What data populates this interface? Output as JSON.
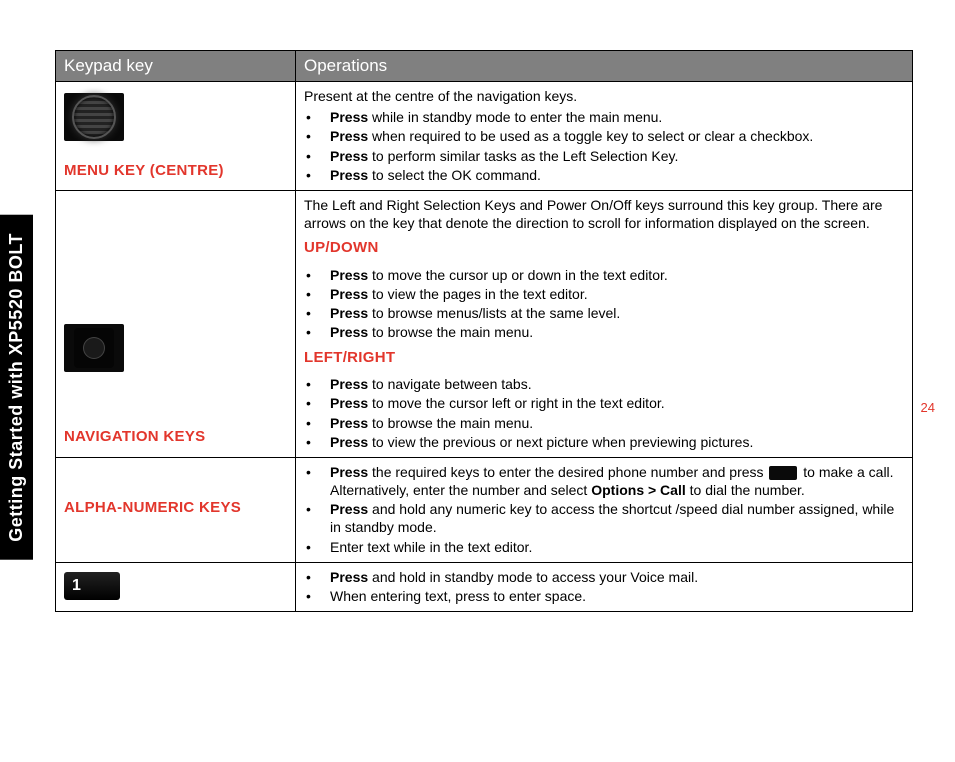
{
  "sidebar": {
    "title": "Getting Started with XP5520 BOLT"
  },
  "page_number": "24",
  "table": {
    "headers": {
      "col1": "Keypad key",
      "col2": "Operations"
    },
    "rows": {
      "menu_key": {
        "label": "MENU KEY (CENTRE)",
        "intro": "Present at the centre of the navigation keys.",
        "bullets": [
          {
            "bold": "Press",
            "rest": " while in standby mode to enter the main menu."
          },
          {
            "bold": "Press",
            "rest": " when required to be used as a toggle key to select or clear a checkbox."
          },
          {
            "bold": "Press",
            "rest": " to perform similar tasks as the Left Selection Key."
          },
          {
            "bold": "Press",
            "rest": " to select the OK command."
          }
        ]
      },
      "nav_keys": {
        "label": "NAVIGATION KEYS",
        "intro": "The Left and Right Selection Keys and Power On/Off keys surround this key group. There are arrows on the key that denote the direction to scroll for information displayed on the screen.",
        "up_down_label": "UP/DOWN",
        "up_down_bullets": [
          {
            "bold": "Press",
            "rest": " to move the cursor up or down in the text editor."
          },
          {
            "bold": "Press",
            "rest": " to view the pages in the text editor."
          },
          {
            "bold": "Press",
            "rest": " to browse menus/lists at the same level."
          },
          {
            "bold": "Press",
            "rest": " to browse the main menu."
          }
        ],
        "left_right_label": "LEFT/RIGHT",
        "left_right_bullets": [
          {
            "bold": "Press",
            "rest": " to navigate between tabs."
          },
          {
            "bold": "Press",
            "rest": " to move the cursor left or right in the text editor."
          },
          {
            "bold": "Press",
            "rest": " to browse the main menu."
          },
          {
            "bold": "Press",
            "rest": " to view the previous or next picture when previewing pictures."
          }
        ]
      },
      "alpha_keys": {
        "label": "ALPHA-NUMERIC KEYS",
        "bullet1_pre": "Press",
        "bullet1_mid": " the required keys to enter the desired phone number and press ",
        "bullet1_post": " to make a call. Alternatively, enter the number and select ",
        "bullet1_bold2": "Options > Call",
        "bullet1_end": " to dial the number.",
        "bullet2_bold": "Press",
        "bullet2_rest": " and hold any numeric key to access the shortcut /speed dial number assigned, while in standby mode.",
        "bullet3": "Enter text while in the text editor."
      },
      "one_key": {
        "icon_text": "1",
        "bullets": [
          {
            "bold": "Press",
            "rest": " and hold in standby mode to access your Voice mail."
          },
          {
            "plain": "When entering text, press to enter space."
          }
        ]
      }
    }
  }
}
